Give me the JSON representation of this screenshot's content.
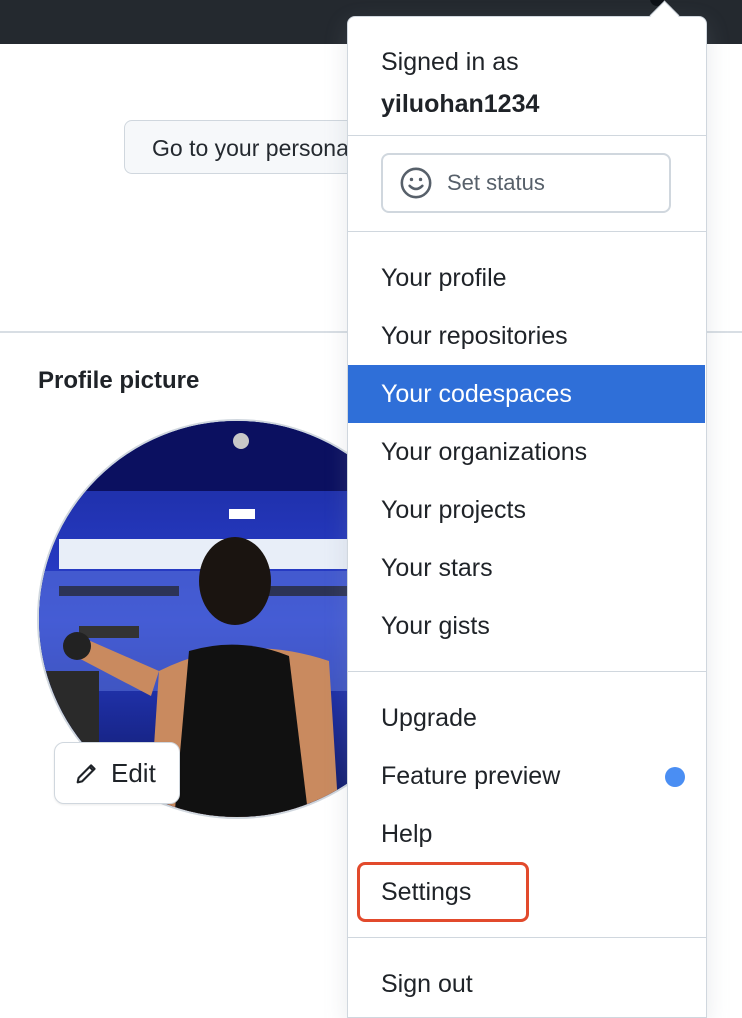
{
  "page": {
    "personal_button_label": "Go to your personal profile",
    "section_title": "Profile picture",
    "edit_label": "Edit"
  },
  "menu": {
    "signed_in_prefix": "Signed in as",
    "username": "yiluohan1234",
    "set_status_label": "Set status",
    "items_group1": [
      {
        "label": "Your profile",
        "active": false
      },
      {
        "label": "Your repositories",
        "active": false
      },
      {
        "label": "Your codespaces",
        "active": true
      },
      {
        "label": "Your organizations",
        "active": false
      },
      {
        "label": "Your projects",
        "active": false
      },
      {
        "label": "Your stars",
        "active": false
      },
      {
        "label": "Your gists",
        "active": false
      }
    ],
    "items_group2": [
      {
        "label": "Upgrade"
      },
      {
        "label": "Feature preview",
        "badge": "new-dot"
      },
      {
        "label": "Help"
      },
      {
        "label": "Settings",
        "highlighted": true
      }
    ],
    "sign_out_label": "Sign out"
  },
  "colors": {
    "active_item_bg": "#2f6fd8",
    "highlight_border": "#e24a2c",
    "feature_dot": "#4a8ef3",
    "topbar": "#24292f"
  }
}
